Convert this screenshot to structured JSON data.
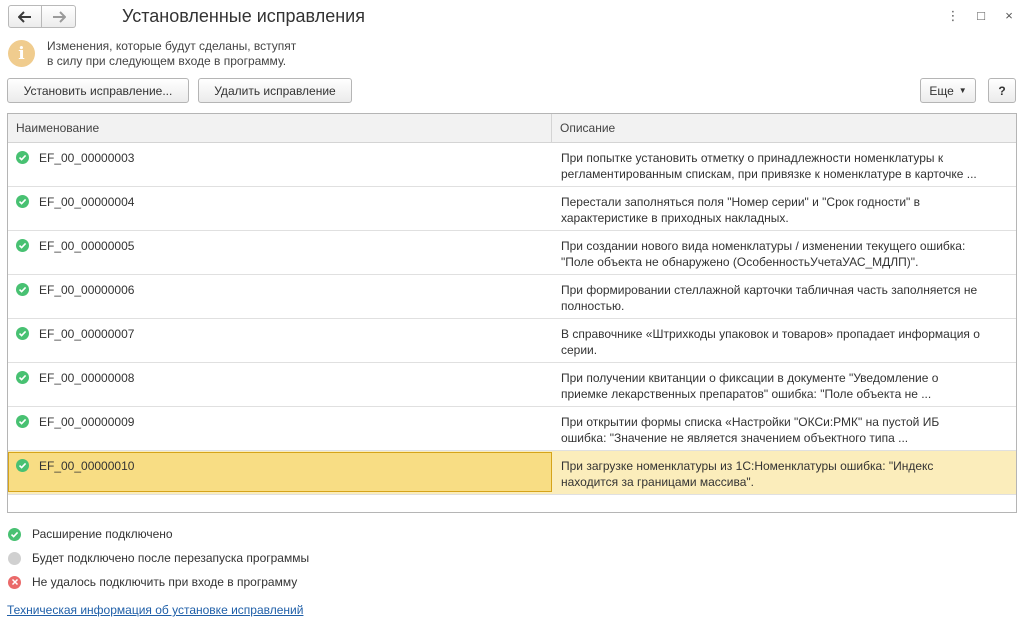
{
  "header": {
    "title": "Установленные исправления",
    "back_icon": "arrow-left-icon",
    "forward_icon": "arrow-right-icon",
    "menu_icon": "⋮",
    "maximize_icon": "□",
    "close_icon": "×"
  },
  "info": {
    "icon_text": "i",
    "line1": "Изменения, которые будут сделаны, вступят",
    "line2": "в силу при следующем входе в программу."
  },
  "toolbar": {
    "install_label": "Установить исправление...",
    "remove_label": "Удалить исправление",
    "more_label": "Еще",
    "help_label": "?"
  },
  "table": {
    "columns": {
      "name": "Наименование",
      "description": "Описание"
    },
    "rows": [
      {
        "name": "EF_00_00000003",
        "status": "connected",
        "desc1": "При попытке установить отметку о принадлежности номенклатуры к",
        "desc2": "регламентированным спискам, при привязке к номенклатуре в карточке ..."
      },
      {
        "name": "EF_00_00000004",
        "status": "connected",
        "desc1": "Перестали заполняться поля \"Номер серии\" и \"Срок годности\" в",
        "desc2": "характеристике в приходных накладных."
      },
      {
        "name": "EF_00_00000005",
        "status": "connected",
        "desc1": "При создании нового вида номенклатуры / изменении текущего ошибка:",
        "desc2": "\"Поле объекта не обнаружено (ОсобенностьУчетаУАС_МДЛП)\"."
      },
      {
        "name": "EF_00_00000006",
        "status": "connected",
        "desc1": "При формировании стеллажной карточки табличная часть заполняется не",
        "desc2": "полностью."
      },
      {
        "name": "EF_00_00000007",
        "status": "connected",
        "desc1": "В справочнике «Штрихкоды упаковок и товаров» пропадает информация о",
        "desc2": "серии."
      },
      {
        "name": "EF_00_00000008",
        "status": "connected",
        "desc1": "При получении квитанции о фиксации в документе \"Уведомление о",
        "desc2": "приемке лекарственных препаратов\" ошибка: \"Поле объекта не ..."
      },
      {
        "name": "EF_00_00000009",
        "status": "connected",
        "desc1": "При открытии формы списка «Настройки \"ОКСи:РМК\" на пустой ИБ",
        "desc2": "ошибка: \"Значение не является значением объектного типа ..."
      },
      {
        "name": "EF_00_00000010",
        "status": "connected",
        "selected": true,
        "desc1": "При загрузке номенклатуры из 1С:Номенклатуры ошибка: \"Индекс",
        "desc2": "находится за границами массива\"."
      }
    ]
  },
  "legend": {
    "connected": "Расширение подключено",
    "pending": "Будет подключено после перезапуска программы",
    "failed": "Не удалось подключить при входе в программу"
  },
  "link": {
    "label": "Техническая информация об установке исправлений"
  },
  "colors": {
    "green": "#48c172",
    "gray": "#d0d0d0",
    "red": "#ea6a6a",
    "selected_row": "#fbedbb",
    "selected_cell": "#f8dd84",
    "link": "#1f5fa8"
  }
}
